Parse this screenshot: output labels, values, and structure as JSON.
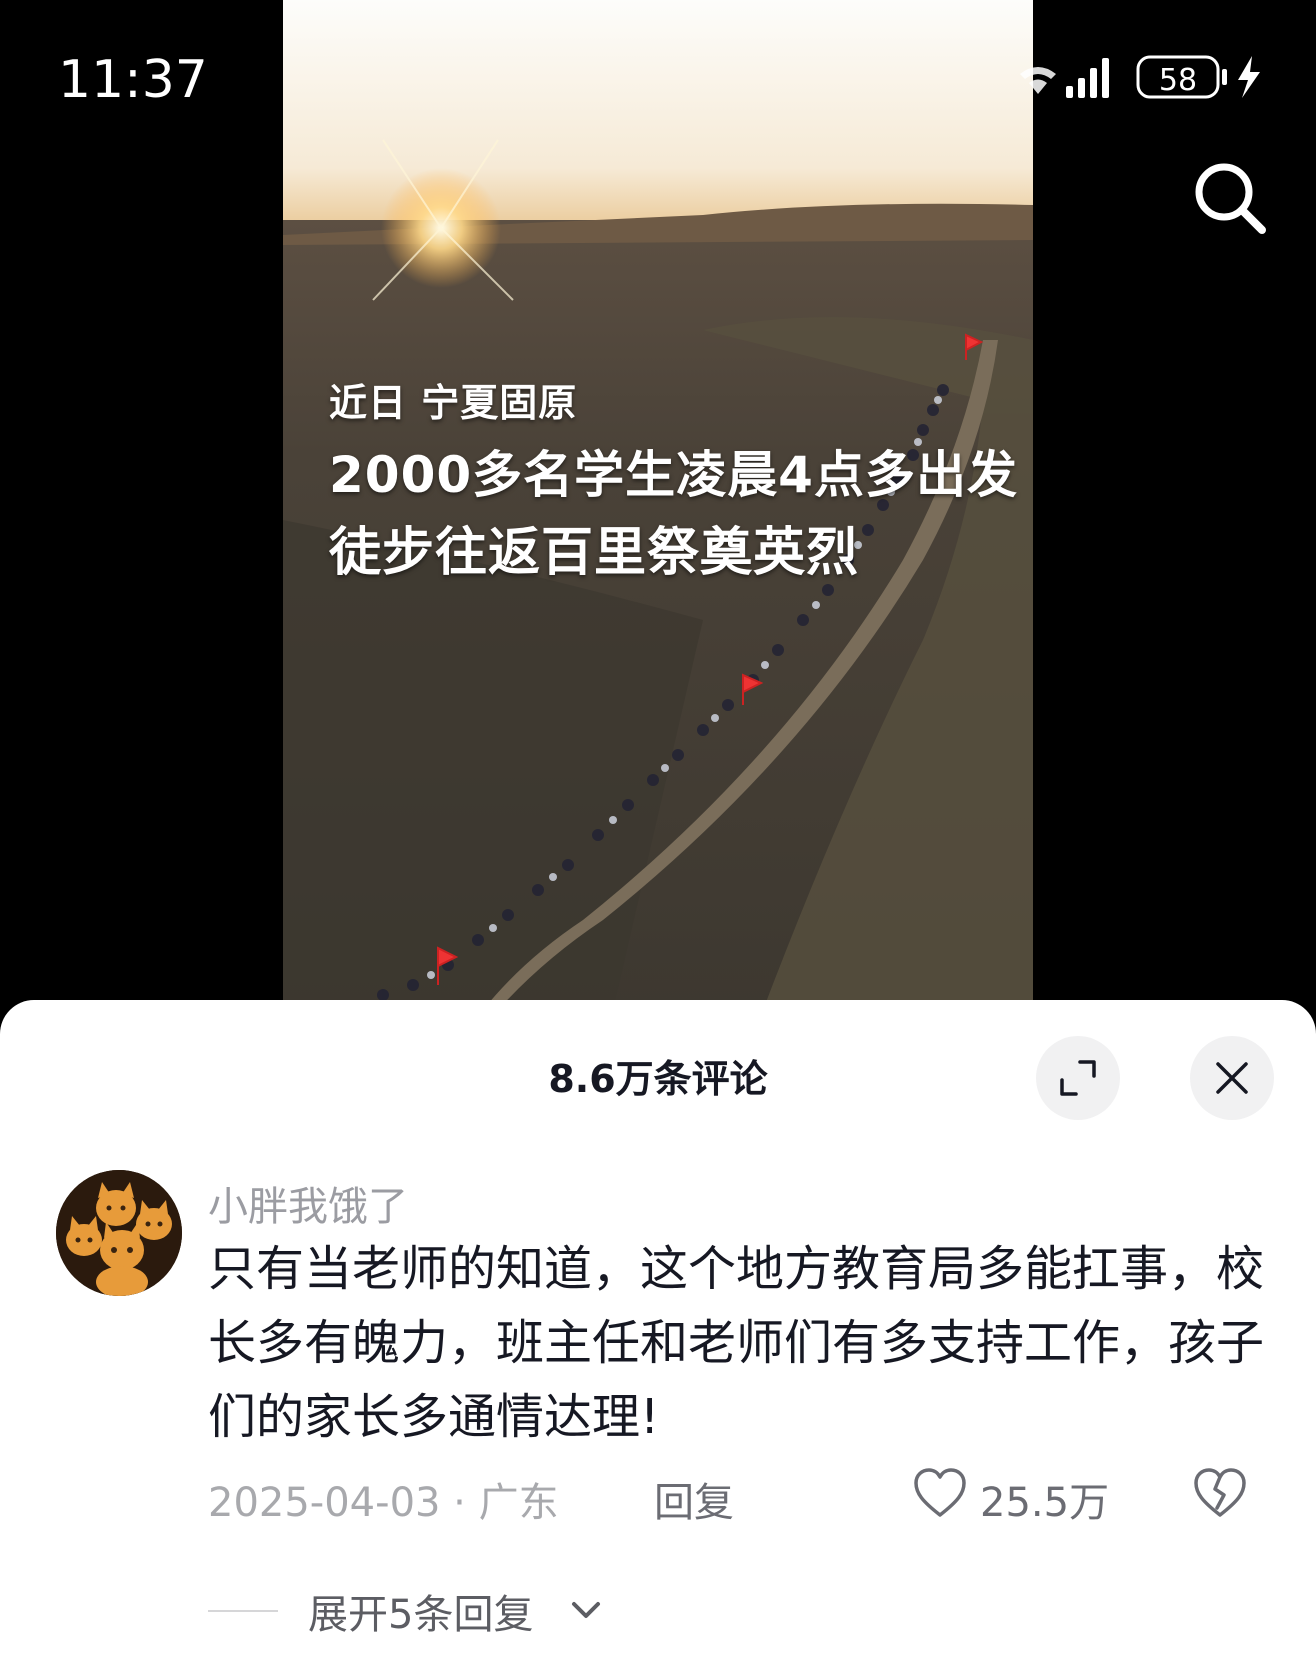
{
  "status_bar": {
    "time": "11:37",
    "battery": "58",
    "icons": [
      "wifi-icon",
      "signal-icon",
      "battery-icon",
      "charging-icon"
    ]
  },
  "video": {
    "caption_sub": "近日 宁夏固原",
    "caption_line1": "2000多名学生凌晨4点多出发",
    "caption_line2": "徒步往返百里祭奠英烈"
  },
  "comments_panel": {
    "title": "8.6万条评论",
    "expand_icon": "expand-icon",
    "close_icon": "close-icon"
  },
  "comment": {
    "username": "小胖我饿了",
    "text": "只有当老师的知道，这个地方教育局多能扛事，校长多有魄力，班主任和老师们有多支持工作，孩子们的家长多通情达理!",
    "meta": "2025-04-03 · 广东",
    "reply_label": "回复",
    "like_count": "25.5万",
    "expand_replies_label": "展开5条回复"
  }
}
